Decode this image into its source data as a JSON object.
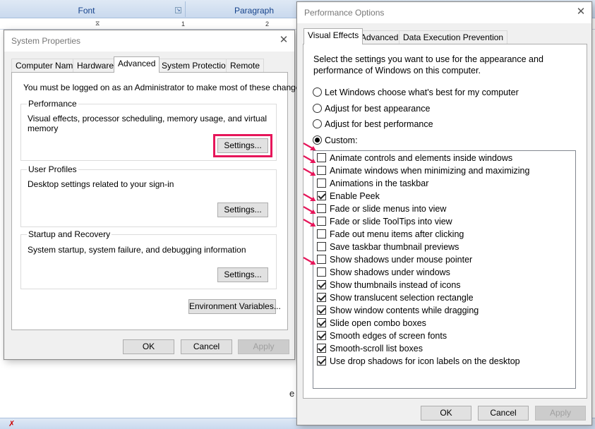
{
  "background": {
    "ribbon_groups": [
      "Font",
      "Paragraph"
    ],
    "ruler_marks": [
      "1",
      "2"
    ]
  },
  "system_properties": {
    "title": "System Properties",
    "tabs": [
      "Computer Name",
      "Hardware",
      "Advanced",
      "System Protection",
      "Remote"
    ],
    "active_tab": "Advanced",
    "admin_note": "You must be logged on as an Administrator to make most of these changes.",
    "performance": {
      "label": "Performance",
      "desc": "Visual effects, processor scheduling, memory usage, and virtual memory",
      "button": "Settings..."
    },
    "user_profiles": {
      "label": "User Profiles",
      "desc": "Desktop settings related to your sign-in",
      "button": "Settings..."
    },
    "startup_recovery": {
      "label": "Startup and Recovery",
      "desc": "System startup, system failure, and debugging information",
      "button": "Settings..."
    },
    "env_button": "Environment Variables...",
    "ok": "OK",
    "cancel": "Cancel",
    "apply": "Apply"
  },
  "performance_options": {
    "title": "Performance Options",
    "tabs": [
      "Visual Effects",
      "Advanced",
      "Data Execution Prevention"
    ],
    "active_tab": "Visual Effects",
    "intro": [
      "Select the settings you want to use for the appearance and",
      "performance of Windows on this computer."
    ],
    "radios": [
      {
        "label": "Let Windows choose what's best for my computer",
        "checked": false
      },
      {
        "label": "Adjust for best appearance",
        "checked": false
      },
      {
        "label": "Adjust for best performance",
        "checked": false
      },
      {
        "label": "Custom:",
        "checked": true
      }
    ],
    "effects": [
      {
        "label": "Animate controls and elements inside windows",
        "checked": false,
        "marked": true
      },
      {
        "label": "Animate windows when minimizing and maximizing",
        "checked": false,
        "marked": true
      },
      {
        "label": "Animations in the taskbar",
        "checked": false,
        "marked": true
      },
      {
        "label": "Enable Peek",
        "checked": true,
        "marked": false
      },
      {
        "label": "Fade or slide menus into view",
        "checked": false,
        "marked": true
      },
      {
        "label": "Fade or slide ToolTips into view",
        "checked": false,
        "marked": true
      },
      {
        "label": "Fade out menu items after clicking",
        "checked": false,
        "marked": true
      },
      {
        "label": "Save taskbar thumbnail previews",
        "checked": false,
        "marked": false
      },
      {
        "label": "Show shadows under mouse pointer",
        "checked": false,
        "marked": false
      },
      {
        "label": "Show shadows under windows",
        "checked": false,
        "marked": true
      },
      {
        "label": "Show thumbnails instead of icons",
        "checked": true,
        "marked": false
      },
      {
        "label": "Show translucent selection rectangle",
        "checked": true,
        "marked": false
      },
      {
        "label": "Show window contents while dragging",
        "checked": true,
        "marked": false
      },
      {
        "label": "Slide open combo boxes",
        "checked": true,
        "marked": false
      },
      {
        "label": "Smooth edges of screen fonts",
        "checked": true,
        "marked": false
      },
      {
        "label": "Smooth-scroll list boxes",
        "checked": true,
        "marked": false
      },
      {
        "label": "Use drop shadows for icon labels on the desktop",
        "checked": true,
        "marked": false
      }
    ],
    "ok": "OK",
    "cancel": "Cancel",
    "apply": "Apply"
  },
  "colors": {
    "highlight": "#e6165a",
    "arrow": "#e6165a"
  }
}
